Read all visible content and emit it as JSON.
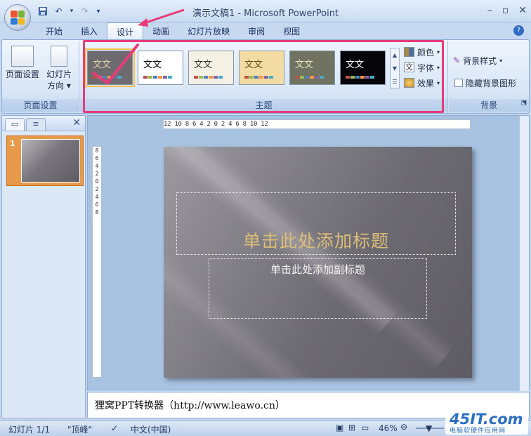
{
  "window": {
    "title": "演示文稿1 - Microsoft PowerPoint"
  },
  "quick_access": {
    "save": "save-icon",
    "undo": "undo-icon",
    "redo": "redo-icon",
    "customize": "▾"
  },
  "tabs": [
    "开始",
    "插入",
    "设计",
    "动画",
    "幻灯片放映",
    "审阅",
    "视图"
  ],
  "active_tab": "设计",
  "ribbon": {
    "page_setup": {
      "page_setup_label": "页面设置",
      "orientation_label": "幻灯片\n方向",
      "group_label": "页面设置"
    },
    "themes": {
      "group_label": "主题",
      "items": [
        {
          "text": "文文",
          "bg": "#6d6a70",
          "fg": "#e0d2a8",
          "selected": true
        },
        {
          "text": "文文",
          "bg": "#ffffff",
          "fg": "#000000",
          "selected": false
        },
        {
          "text": "文文",
          "bg": "#f4f0e4",
          "fg": "#333333",
          "selected": false
        },
        {
          "text": "文文",
          "bg": "#f3dca4",
          "fg": "#6b4a10",
          "selected": false
        },
        {
          "text": "文文",
          "bg": "#6f735f",
          "fg": "#e8e2c0",
          "selected": false
        },
        {
          "text": "文文",
          "bg": "#06060a",
          "fg": "#ffffff",
          "selected": false
        }
      ],
      "colors_label": "颜色",
      "fonts_label": "字体",
      "effects_label": "效果"
    },
    "background": {
      "styles_label": "背景样式",
      "hide_label": "隐藏背景图形",
      "group_label": "背景"
    }
  },
  "left_panel": {
    "slide_number": "1"
  },
  "ruler": {
    "horizontal": "12  10   8   6   4   2   0   2   4   6   8  10  12",
    "vertical": "8 6 4 2 0 2 4 6 8"
  },
  "slide": {
    "title_placeholder": "单击此处添加标题",
    "subtitle_placeholder": "单击此处添加副标题"
  },
  "notes": {
    "text": "狸窝PPT转换器（http://www.leawo.cn）"
  },
  "status": {
    "slide_info": "幻灯片 1/1",
    "theme_name": "\"顶峰\"",
    "language": "中文(中国)",
    "zoom": "46%"
  },
  "watermark": {
    "main": "45IT.com",
    "sub": "电脑软硬件应用网"
  }
}
